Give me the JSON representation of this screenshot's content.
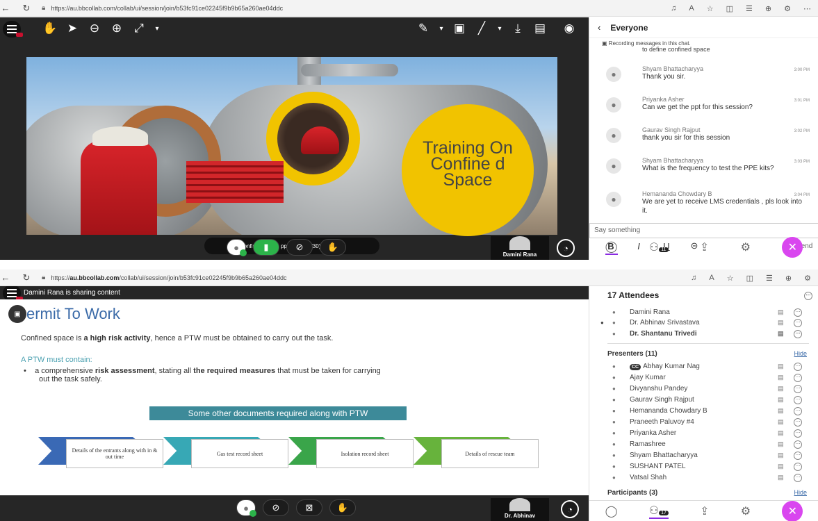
{
  "top": {
    "browser": {
      "url": "https://au.bbcollab.com/collab/ui/session/join/b53fc91ce02245f9b9b65a260ae04ddc"
    },
    "slide_badge": "Training On Confine d Space",
    "file_label": "Confined Space ppt.pptx",
    "page_count": "(1/30)",
    "tile_name": "Damini Rana",
    "chat": {
      "header": "Everyone",
      "recording_notice": "Recording messages in this chat.",
      "partial_line": "to define confined space",
      "messages": [
        {
          "name": "Shyam Bhattacharyya",
          "time": "3:00 PM",
          "text": "Thank you sir."
        },
        {
          "name": "Priyanka Asher",
          "time": "3:01 PM",
          "text": "Can we get the ppt for this session?"
        },
        {
          "name": "Gaurav Singh Rajput",
          "time": "3:02 PM",
          "text": "thank you sir for this session"
        },
        {
          "name": "Shyam Bhattacharyya",
          "time": "3:03 PM",
          "text": "What is the frequency to test the PPE kits?"
        },
        {
          "name": "Hemananda Chowdary B",
          "time": "3:04 PM",
          "text": "We are yet to receive LMS credentials , pls look into it."
        }
      ],
      "input_placeholder": "Say something",
      "send_label": "Send",
      "attendee_count_badge": "11"
    }
  },
  "bottom": {
    "browser": {
      "url_prefix": "https://",
      "url_host": "au.bbcollab.com",
      "url_path": "/collab/ui/session/join/b53fc91ce02245f9b9b65a260ae04ddc"
    },
    "sharing_text": "Damini Rana is sharing content",
    "slide": {
      "title": "ermit To Work",
      "line1_a": "Confined space is ",
      "line1_b": "a high risk activity",
      "line1_c": ", hence a PTW must be obtained to carry out the task.",
      "subhead": "A PTW must contain:",
      "bullet_a": "a comprehensive ",
      "bullet_b": "risk assessment",
      "bullet_c": ", stating all ",
      "bullet_d": "the required measures",
      "bullet_e": " that must be taken for carrying",
      "bullet_f": "out the task safely.",
      "banner": "Some other documents required along with PTW",
      "steps": [
        "Details of the entrants along with in & out time",
        "Gas test record sheet",
        "Isolation record sheet",
        "Details of rescue team"
      ],
      "step_colors": [
        "#3a69b5",
        "#37a8b5",
        "#3aa54a",
        "#67b33c"
      ]
    },
    "tile_name": "Dr. Abhinav",
    "attendees": {
      "header": "17 Attendees",
      "top": [
        "Damini Rana",
        "Dr. Abhinav Srivastava",
        "Dr. Shantanu Trivedi"
      ],
      "presenters_label": "Presenters (11)",
      "hide_label": "Hide",
      "presenters": [
        "Abhay Kumar Nag",
        "Ajay Kumar",
        "Divyanshu Pandey",
        "Gaurav Singh Rajput",
        "Hemananda Chowdary B",
        "Praneeth Paluvoy #4",
        "Priyanka Asher",
        "Ramashree",
        "Shyam Bhattacharyya",
        "SUSHANT PATEL",
        "Vatsal Shah"
      ],
      "cc_badge": "CC",
      "participants_label": "Participants (3)",
      "attendee_count_badge": "17"
    }
  }
}
